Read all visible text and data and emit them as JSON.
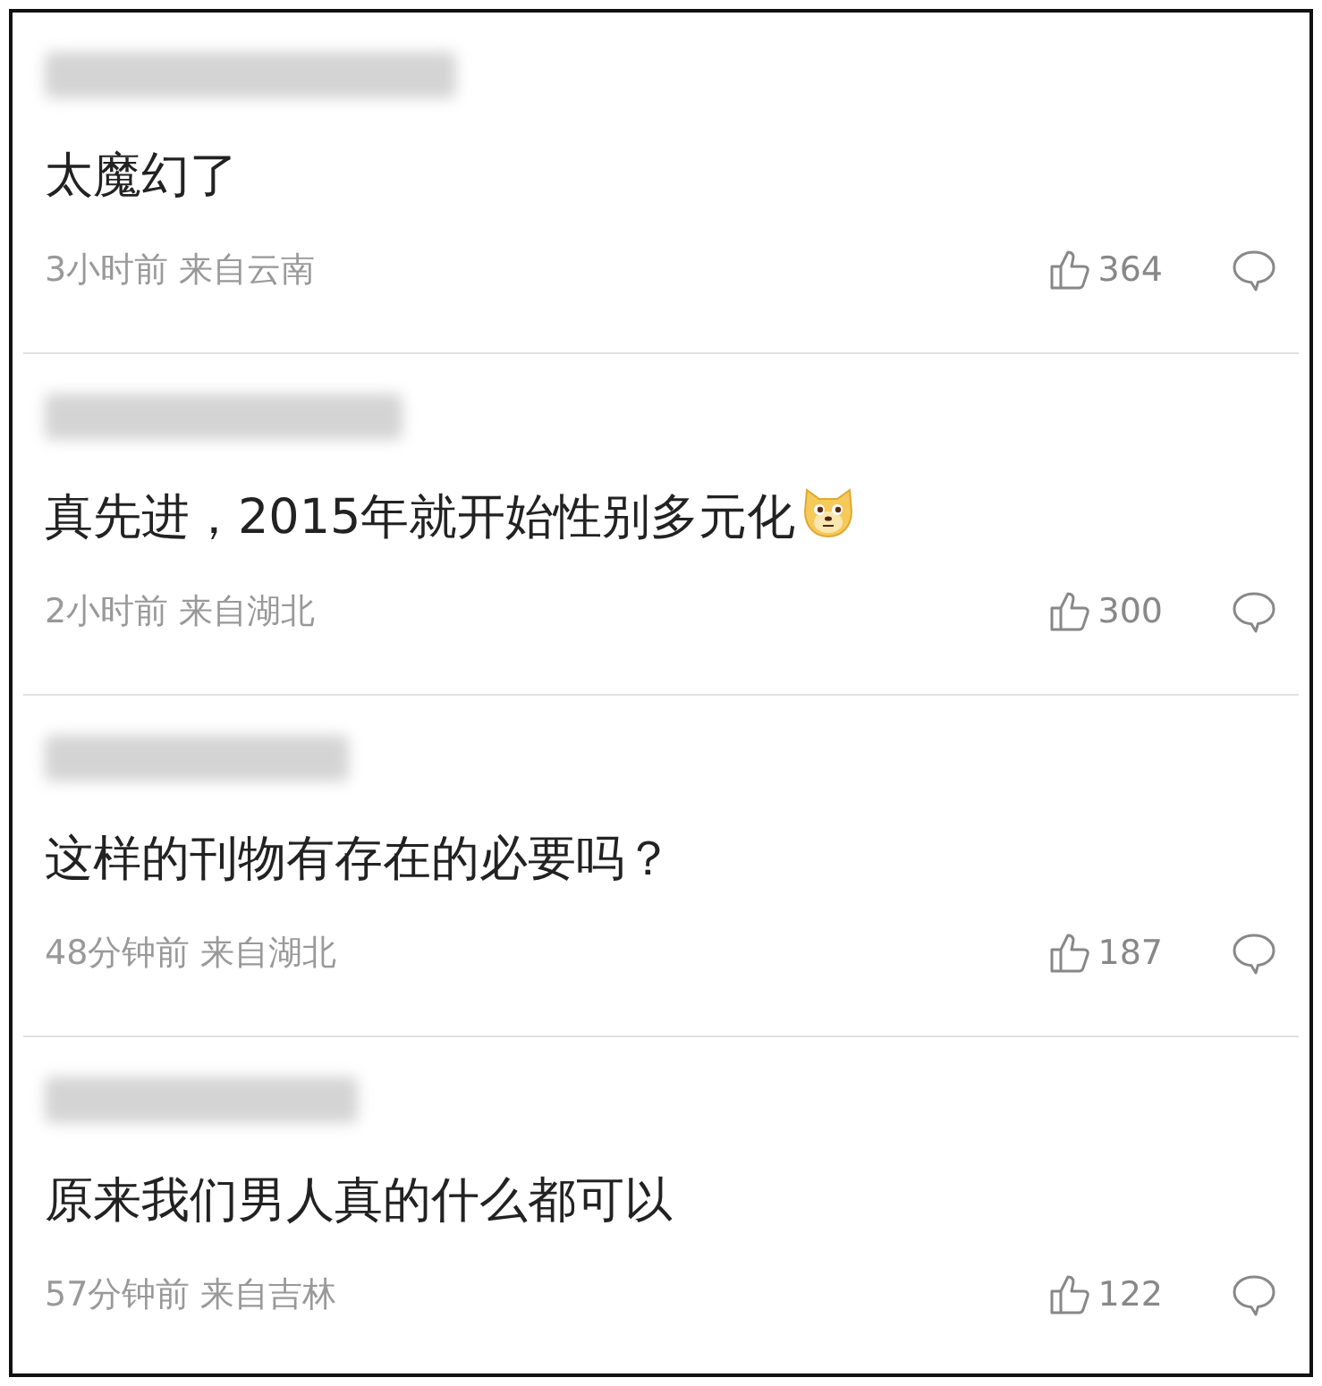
{
  "comments": [
    {
      "text": "太魔幻了",
      "emoji_after": false,
      "time": "3小时前",
      "location": "来自云南",
      "likes": "364"
    },
    {
      "text": "真先进，2015年就开始性别多元化",
      "emoji_after": true,
      "time": "2小时前",
      "location": "来自湖北",
      "likes": "300"
    },
    {
      "text": "这样的刊物有存在的必要吗？",
      "emoji_after": false,
      "time": "48分钟前",
      "location": "来自湖北",
      "likes": "187"
    },
    {
      "text": "原来我们男人真的什么都可以",
      "emoji_after": false,
      "time": "57分钟前",
      "location": "来自吉林",
      "likes": "122"
    }
  ]
}
